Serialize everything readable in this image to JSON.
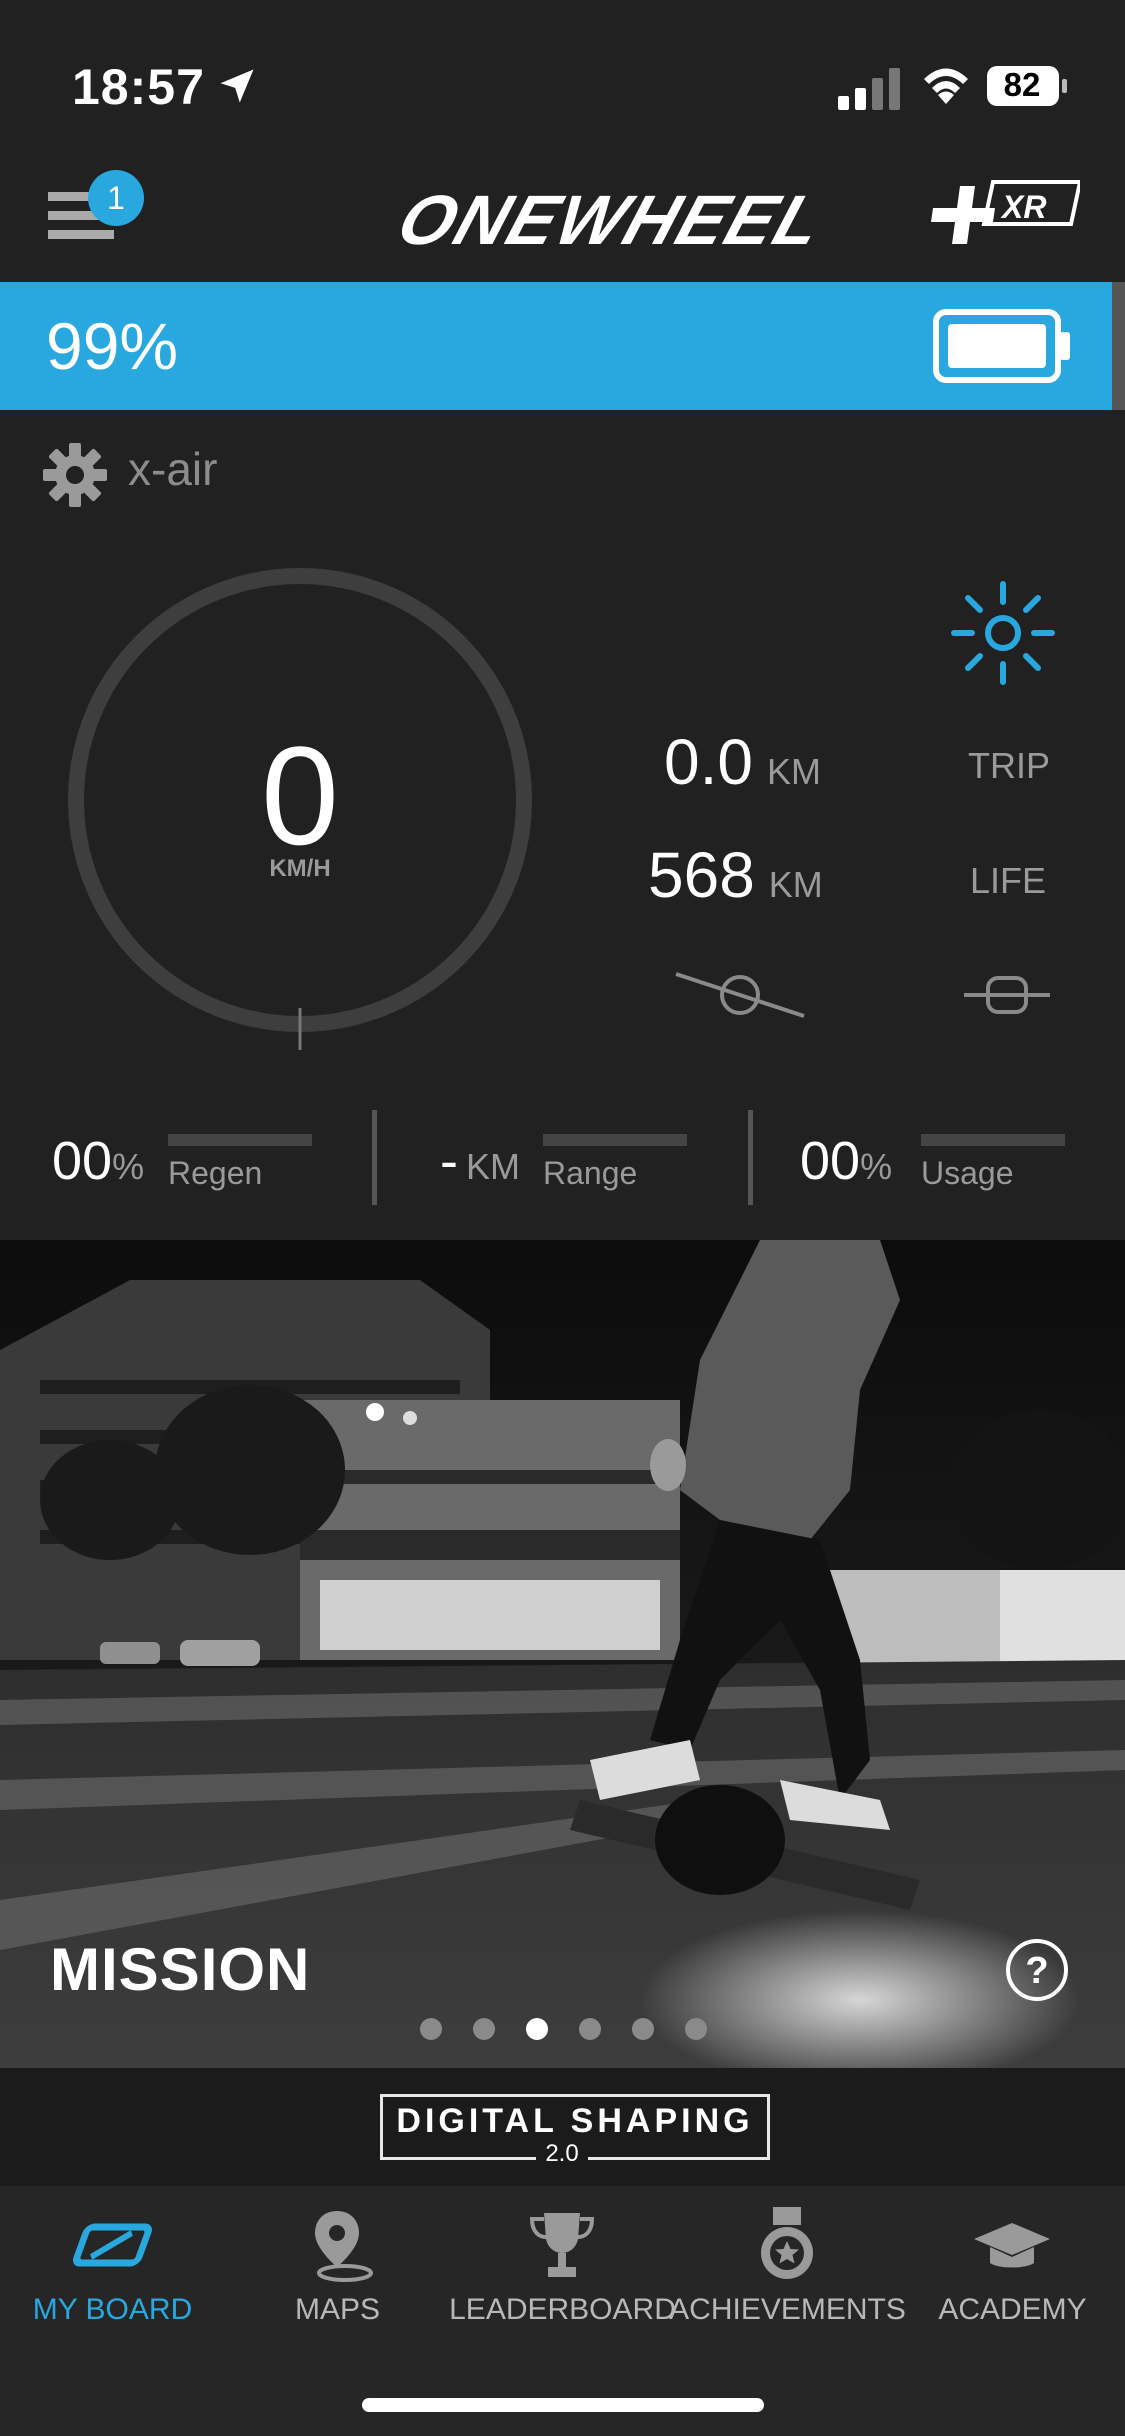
{
  "status_bar": {
    "time": "18:57",
    "battery": "82"
  },
  "header": {
    "badge_count": "1",
    "logo_text": "ONEWHEEL",
    "logo_badge": "XR"
  },
  "battery_banner": {
    "percent": "99%",
    "level": 0.99
  },
  "board": {
    "name": "x-air"
  },
  "speed": {
    "value": "0",
    "unit": "KM/H"
  },
  "stats": {
    "trip": {
      "value": "0.0",
      "unit": "KM",
      "label": "TRIP"
    },
    "life": {
      "value": "568",
      "unit": "KM",
      "label": "LIFE"
    }
  },
  "metrics": [
    {
      "value": "00",
      "suffix": "%",
      "label": "Regen"
    },
    {
      "value": "-",
      "suffix": "KM",
      "label": "Range"
    },
    {
      "value": "00",
      "suffix": "%",
      "label": "Usage"
    }
  ],
  "hero": {
    "title": "MISSION",
    "dots_count": 6,
    "active_dot": 3
  },
  "digital_shaping": {
    "label": "DIGITAL SHAPING",
    "version": "2.0"
  },
  "nav": [
    {
      "label": "MY BOARD",
      "icon": "board-icon",
      "active": true
    },
    {
      "label": "MAPS",
      "icon": "map-pin-icon",
      "active": false
    },
    {
      "label": "LEADERBOARD",
      "icon": "trophy-icon",
      "active": false
    },
    {
      "label": "ACHIEVEMENTS",
      "icon": "medal-icon",
      "active": false
    },
    {
      "label": "ACADEMY",
      "icon": "graduation-cap-icon",
      "active": false
    }
  ],
  "colors": {
    "accent": "#29a8e0",
    "background": "#212121",
    "muted": "#9a9a9a"
  }
}
